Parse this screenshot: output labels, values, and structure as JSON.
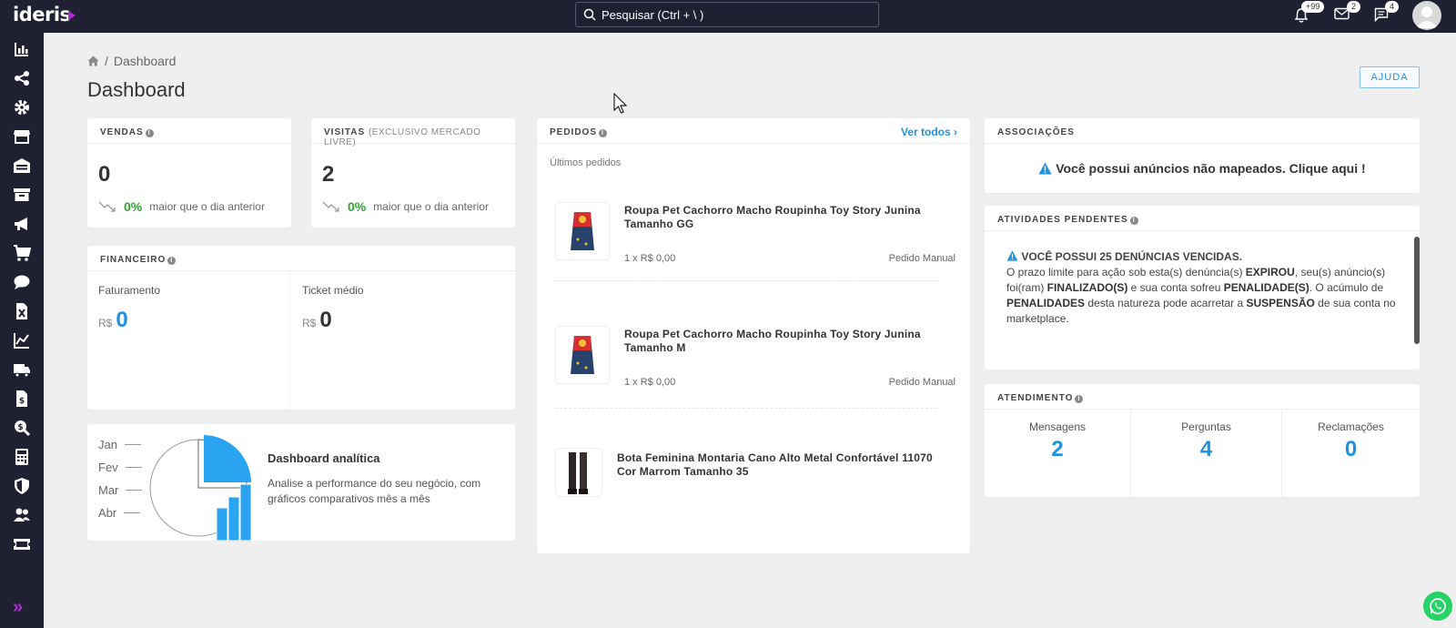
{
  "app": {
    "logo_text": "ideris"
  },
  "search": {
    "placeholder": "Pesquisar (Ctrl + \\ )"
  },
  "topbar": {
    "notifications_badge": "+99",
    "messages_badge": "2",
    "chat_badge": "4"
  },
  "breadcrumb": {
    "current": "Dashboard"
  },
  "page": {
    "title": "Dashboard",
    "help_label": "AJUDA"
  },
  "vendas": {
    "title": "VENDAS",
    "value": "0",
    "pct": "0%",
    "compare": "maior que o dia anterior"
  },
  "visitas": {
    "title": "VISITAS",
    "subtitle": "(EXCLUSIVO MERCADO LIVRE)",
    "value": "2",
    "pct": "0%",
    "compare": "maior que o dia anterior"
  },
  "financeiro": {
    "title": "FINANCEIRO",
    "faturamento_label": "Faturamento",
    "faturamento_currency": "R$",
    "faturamento_value": "0",
    "ticket_label": "Ticket médio",
    "ticket_currency": "R$",
    "ticket_value": "0"
  },
  "dashboard_analitica": {
    "months": [
      "Jan",
      "Fev",
      "Mar",
      "Abr"
    ],
    "title": "Dashboard analítica",
    "description": "Analise a performance do seu negócio, com gráficos comparativos mês a mês"
  },
  "pedidos": {
    "title": "PEDIDOS",
    "ver_todos": "Ver todos",
    "subtitle": "Últimos pedidos",
    "orders": [
      {
        "title": "Roupa Pet Cachorro Macho Roupinha Toy Story Junina Tamanho GG",
        "qty": "1 x R$ 0,00",
        "source": "Pedido Manual"
      },
      {
        "title": "Roupa Pet Cachorro Macho Roupinha Toy Story Junina Tamanho M",
        "qty": "1 x R$ 0,00",
        "source": "Pedido Manual"
      },
      {
        "title": "Bota Feminina Montaria Cano Alto Metal Confortável 11070 Cor Marrom Tamanho 35",
        "qty": "",
        "source": ""
      }
    ]
  },
  "associacoes": {
    "title": "ASSOCIAÇÕES",
    "message": "Você possui anúncios não mapeados. Clique aqui !"
  },
  "atividades": {
    "title": "ATIVIDADES PENDENTES",
    "headline": "VOCÊ POSSUI 25 DENÚNCIAS VENCIDAS.",
    "t1": "O prazo limite para ação sob esta(s) denúncia(s) ",
    "b1": "EXPIROU",
    "t2": ", seu(s) anúncio(s) foi(ram) ",
    "b2": "FINALIZADO(S)",
    "t3": " e sua conta sofreu ",
    "b3": "PENALIDADE(S)",
    "t4": ". O acúmulo de ",
    "b4": "PENALIDADES",
    "t5": " desta natureza pode acarretar a ",
    "b5": "SUSPENSÃO",
    "t6": " de sua conta no marketplace."
  },
  "atendimento": {
    "title": "ATENDIMENTO",
    "mensagens_label": "Mensagens",
    "mensagens_value": "2",
    "perguntas_label": "Perguntas",
    "perguntas_value": "4",
    "reclamacoes_label": "Reclamações",
    "reclamacoes_value": "0"
  },
  "colors": {
    "topbar": "#1f2133",
    "accent_blue": "#1e93e3",
    "brand_purple": "#b12bd6",
    "positive_green": "#2ea72e"
  },
  "icons": {
    "sidebar": [
      "chart-bar-icon",
      "share-icon",
      "gear-icon",
      "store-icon",
      "warehouse-icon",
      "archive-icon",
      "megaphone-icon",
      "cart-icon",
      "chat-bubble-icon",
      "excel-file-icon",
      "line-chart-icon",
      "truck-icon",
      "invoice-file-icon",
      "search-dollar-icon",
      "calculator-icon",
      "shield-icon",
      "users-icon",
      "ticket-icon"
    ]
  }
}
